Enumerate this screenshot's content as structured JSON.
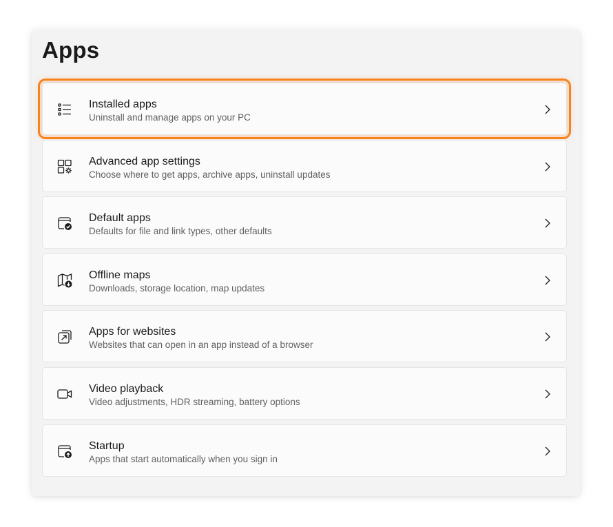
{
  "page": {
    "title": "Apps"
  },
  "colors": {
    "highlight": "#f7821e",
    "panel_bg": "#f3f3f3",
    "card_bg": "#fbfbfb"
  },
  "items": [
    {
      "icon": "list-icon",
      "title": "Installed apps",
      "description": "Uninstall and manage apps on your PC",
      "highlighted": true
    },
    {
      "icon": "app-settings-icon",
      "title": "Advanced app settings",
      "description": "Choose where to get apps, archive apps, uninstall updates",
      "highlighted": false
    },
    {
      "icon": "default-apps-icon",
      "title": "Default apps",
      "description": "Defaults for file and link types, other defaults",
      "highlighted": false
    },
    {
      "icon": "map-download-icon",
      "title": "Offline maps",
      "description": "Downloads, storage location, map updates",
      "highlighted": false
    },
    {
      "icon": "open-external-icon",
      "title": "Apps for websites",
      "description": "Websites that can open in an app instead of a browser",
      "highlighted": false
    },
    {
      "icon": "video-camera-icon",
      "title": "Video playback",
      "description": "Video adjustments, HDR streaming, battery options",
      "highlighted": false
    },
    {
      "icon": "startup-icon",
      "title": "Startup",
      "description": "Apps that start automatically when you sign in",
      "highlighted": false
    }
  ]
}
